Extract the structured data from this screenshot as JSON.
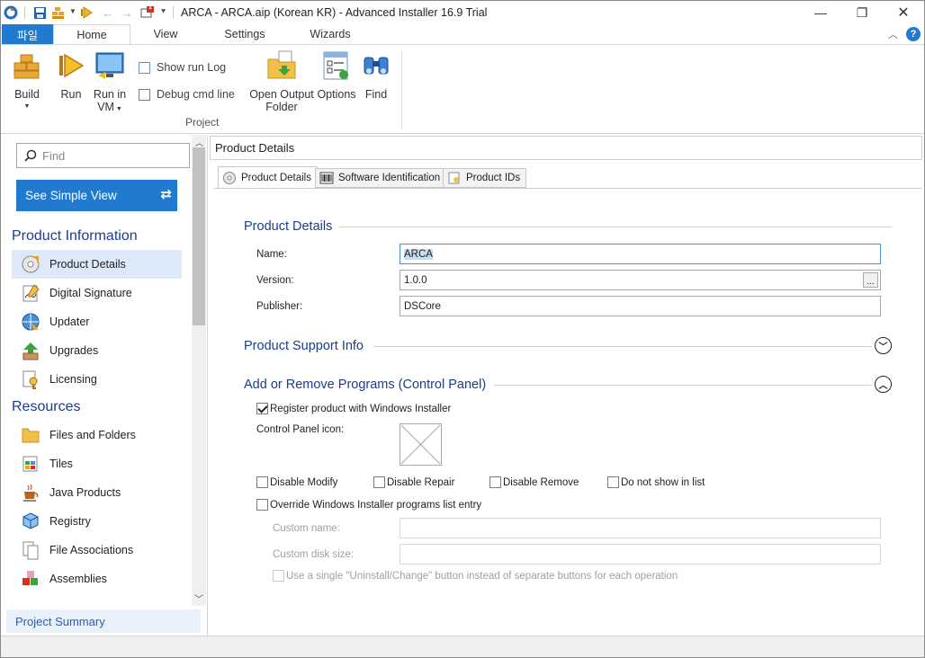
{
  "window": {
    "title": "ARCA - ARCA.aip (Korean KR) - Advanced Installer 16.9 Trial",
    "notification_badge": "1"
  },
  "ribbon_tabs": [
    "파일",
    "Home",
    "View",
    "Settings",
    "Wizards"
  ],
  "ribbon": {
    "build": "Build",
    "run": "Run",
    "run_in_vm_1": "Run in",
    "run_in_vm_2": "VM",
    "show_run_log": "Show run Log",
    "debug_cmd_line": "Debug cmd line",
    "open_output_1": "Open Output",
    "open_output_2": "Folder",
    "options": "Options",
    "find": "Find",
    "group_label": "Project"
  },
  "sidebar": {
    "find_placeholder": "Find",
    "simple_view": "See Simple View",
    "section_product": "Product Information",
    "product_items": [
      "Product Details",
      "Digital Signature",
      "Updater",
      "Upgrades",
      "Licensing"
    ],
    "section_resources": "Resources",
    "resource_items": [
      "Files and Folders",
      "Tiles",
      "Java Products",
      "Registry",
      "File Associations",
      "Assemblies"
    ],
    "project_summary": "Project Summary"
  },
  "main": {
    "header": "Product Details",
    "tabs": [
      "Product Details",
      "Software Identification",
      "Product IDs"
    ],
    "group_product_details": "Product Details",
    "name_label": "Name:",
    "name_value": "ARCA",
    "version_label": "Version:",
    "version_value": "1.0.0",
    "version_browse": "...",
    "publisher_label": "Publisher:",
    "publisher_value": "DSCore",
    "group_support": "Product Support Info",
    "group_arp": "Add or Remove Programs (Control Panel)",
    "register_product": "Register product with Windows Installer",
    "control_panel_icon": "Control Panel icon:",
    "disable_modify": "Disable Modify",
    "disable_repair": "Disable Repair",
    "disable_remove": "Disable Remove",
    "do_not_show": "Do not show in list",
    "override_entry": "Override Windows Installer programs list entry",
    "custom_name": "Custom name:",
    "custom_disk_size": "Custom disk size:",
    "single_button": "Use a single \"Uninstall/Change\" button instead of separate buttons for each operation"
  },
  "colors": {
    "accent": "#1f7ad0",
    "heading": "#1b3d8f"
  }
}
